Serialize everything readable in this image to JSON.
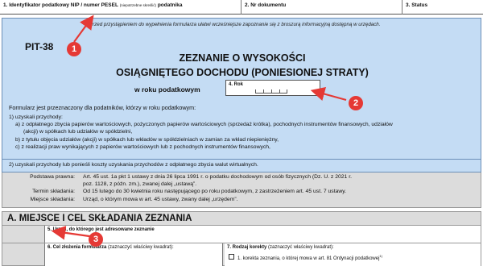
{
  "top": {
    "f1_label": "1. Identyfikator podatkowy NIP / numer PESEL",
    "f1_small": "(niepotrzebne skreślić)",
    "f1_tail": "podatnika",
    "f2_label": "2. Nr dokumentu",
    "f3_label": "3. Status"
  },
  "header": {
    "hint": "Przed przystąpieniem do wypełnienia formularza ułatwi wcześniejsze zapoznanie się z broszurą informacyjną dostępną w urzędach.",
    "form_code": "PIT-38",
    "title_line1": "ZEZNANIE O WYSOKOŚCI",
    "title_line2": "OSIĄGNIĘTEGO DOCHODU (PONIESIONEJ STRATY)",
    "year_label": "w roku podatkowym",
    "year_field_label": "4. Rok"
  },
  "body": {
    "description": "Formularz jest przeznaczony dla podatników, którzy w roku podatkowym:",
    "items": [
      "1) uzyskali przychody:",
      "a) z odpłatnego zbycia papierów wartościowych, pożyczonych papierów wartościowych (sprzedaż krótka), pochodnych instrumentów finansowych, udziałów",
      "(akcji) w spółkach lub udziałów w spółdzielni,",
      "b) z tytułu objęcia udziałów (akcji) w spółkach lub wkładów w spółdzielniach w zamian za wkład niepieniężny,",
      "c) z realizacji praw wynikających z papierów wartościowych lub z pochodnych instrumentów finansowych,"
    ],
    "item2": "2) uzyskali przychody lub ponieśli koszty uzyskania przychodów z odpłatnego zbycia walut wirtualnych."
  },
  "legal": {
    "basis_label": "Podstawa prawna:",
    "basis_line1": "Art. 45 ust. 1a pkt 1 ustawy z dnia 26 lipca 1991 r. o podatku dochodowym od osób fizycznych (Dz. U. z 2021 r.",
    "basis_line2": "poz. 1128, z późn. zm.), zwanej dalej „ustawą”.",
    "deadline_label": "Termin składania:",
    "deadline_value": "Od 15 lutego do 30 kwietnia roku następującego po roku podatkowym, z zastrzeżeniem art. 45 ust. 7 ustawy.",
    "place_label": "Miejsce składania:",
    "place_value": "Urząd, o którym mowa w art. 45 ustawy, zwany dalej „urzędem”."
  },
  "sectionA": {
    "title": "A. MIEJSCE I CEL SKŁADANIA ZEZNANIA",
    "f5_label": "5. Urząd, do którego jest adresowane zeznanie",
    "f6_label": "6. Cel złożenia formularza",
    "f6_hint": "(zaznaczyć właściwy kwadrat):",
    "f7_label": "7. Rodzaj korekty",
    "f7_hint": "(zaznaczyć właściwy kwadrat):",
    "f7_option1": "1. korekta zeznania, o której mowa w art. 81 Ordynacji podatkowej",
    "f7_option1_sup": "1)"
  },
  "annotations": {
    "badge1": "1",
    "badge2": "2",
    "badge3": "3",
    "color": "#e53935"
  }
}
